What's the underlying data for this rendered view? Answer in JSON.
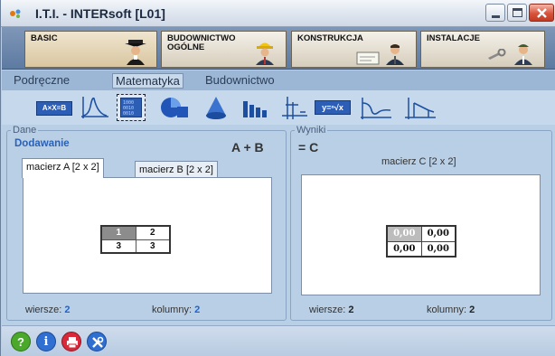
{
  "window": {
    "title": "I.T.I. - INTERsoft [L01]"
  },
  "categories": [
    {
      "label": "BASIC"
    },
    {
      "label": "BUDOWNICTWO OGÓLNE"
    },
    {
      "label": "KONSTRUKCJA"
    },
    {
      "label": "INSTALACJE"
    }
  ],
  "submenu": {
    "items": [
      "Podręczne",
      "Matematyka",
      "Budownictwo"
    ],
    "active": "Matematyka"
  },
  "toolbar": {
    "tools": [
      "axb-icon",
      "gauss-curve-icon",
      "matrix-icon",
      "circle-segment-icon",
      "cone-icon",
      "bar-chart-icon",
      "axes-icon",
      "root-icon",
      "function-icon",
      "integral-icon"
    ],
    "selected": "matrix-icon",
    "labels": {
      "axb": "A×X=B",
      "root": "y=ⁿ√x"
    }
  },
  "input_panel": {
    "legend": "Dane",
    "operation": "Dodawanie",
    "formula": "A + B",
    "tabs": [
      "macierz A [2 x 2]",
      "macierz B [2 x 2]"
    ],
    "matrix": [
      [
        "1",
        "2"
      ],
      [
        "3",
        "3"
      ]
    ],
    "rows_label": "wiersze:",
    "rows_value": "2",
    "cols_label": "kolumny:",
    "cols_value": "2"
  },
  "result_panel": {
    "legend": "Wyniki",
    "formula": "= C",
    "title": "macierz C [2 x 2]",
    "matrix": [
      [
        "0,00",
        "0,00"
      ],
      [
        "0,00",
        "0,00"
      ]
    ],
    "rows_label": "wiersze:",
    "rows_value": "2",
    "cols_label": "kolumny:",
    "cols_value": "2"
  },
  "bottom": {
    "icons": [
      "help-icon",
      "info-icon",
      "print-icon",
      "settings-icon"
    ],
    "glyphs": {
      "help": "?",
      "info": "i"
    }
  },
  "colors": {
    "accent": "#2a61b5",
    "value": "#1e63d2",
    "close": "#d9533c"
  }
}
